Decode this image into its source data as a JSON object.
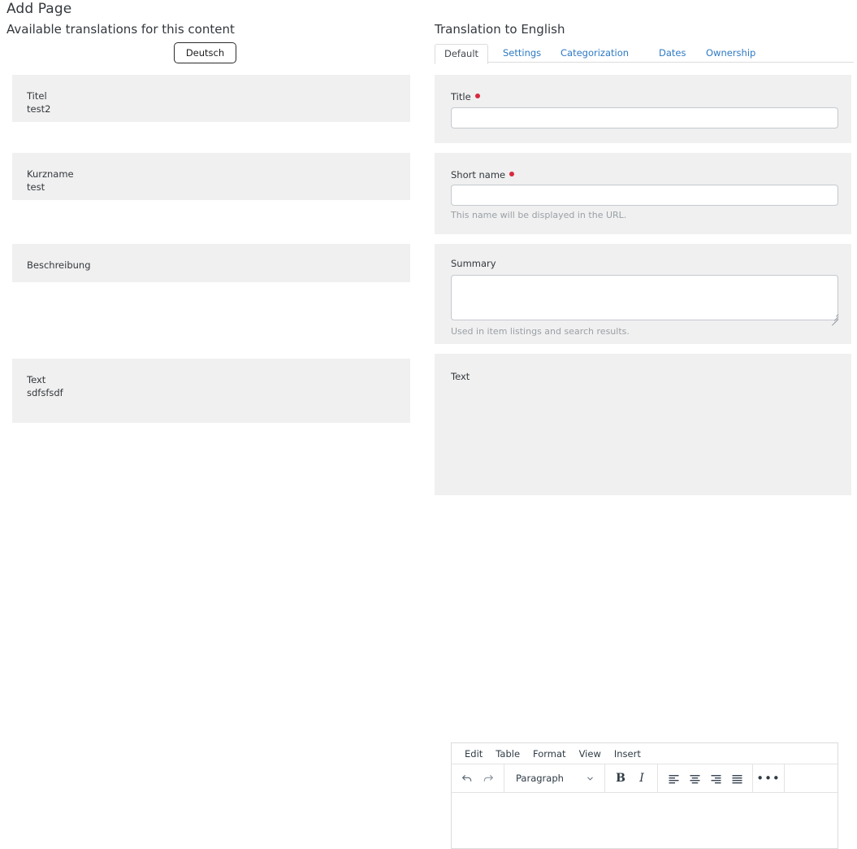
{
  "page": {
    "title": "Add Page"
  },
  "left": {
    "available_label": "Available translations for this content",
    "language_button": "Deutsch",
    "blocks": [
      {
        "label": "Titel",
        "value": "test2"
      },
      {
        "label": "Kurzname",
        "value": "test"
      },
      {
        "label": "Beschreibung",
        "value": ""
      },
      {
        "label": "Text",
        "value": "sdfsfsdf"
      }
    ]
  },
  "right": {
    "heading": "Translation to English",
    "tabs": [
      {
        "label": "Default",
        "active": true
      },
      {
        "label": "Settings",
        "active": false
      },
      {
        "label": "Categorization",
        "active": false
      },
      {
        "label": "Dates",
        "active": false
      },
      {
        "label": "Ownership",
        "active": false
      }
    ],
    "fields": {
      "title": {
        "label": "Title",
        "required": true,
        "value": "",
        "placeholder": ""
      },
      "short_name": {
        "label": "Short name",
        "required": true,
        "value": "",
        "placeholder": "",
        "help": "This name will be displayed in the URL."
      },
      "summary": {
        "label": "Summary",
        "required": false,
        "value": "",
        "placeholder": "",
        "help": "Used in item listings and search results."
      },
      "text": {
        "label": "Text",
        "required": false,
        "value": ""
      }
    },
    "editor": {
      "menubar": [
        "Edit",
        "Table",
        "Format",
        "View",
        "Insert"
      ],
      "format_select": "Paragraph",
      "buttons": {
        "undo": "undo-icon",
        "redo": "redo-icon",
        "bold": "B",
        "italic": "I",
        "align_left": "align-left-icon",
        "align_center": "align-center-icon",
        "align_right": "align-right-icon",
        "align_justify": "align-justify-icon",
        "more": "•••"
      }
    }
  },
  "colors": {
    "panel_bg": "#f0f0f0",
    "page_bg": "#ffffff",
    "link": "#2e7ac4",
    "required_dot": "#d8293d",
    "text": "#33383d",
    "help_text": "#9aa0a6",
    "border": "#c4c9ce"
  }
}
